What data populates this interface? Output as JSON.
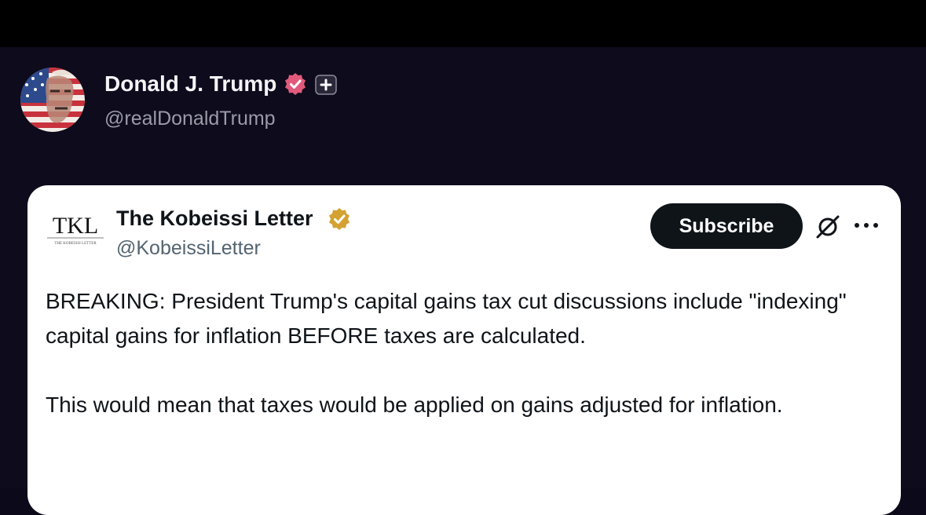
{
  "post": {
    "author": {
      "name": "Donald J. Trump",
      "handle": "@realDonaldTrump",
      "badge_color": "#e25a7b",
      "avatar_icon": "flag-portrait-avatar"
    },
    "quote": {
      "author": {
        "name": "The Kobeissi Letter",
        "handle": "@KobeissiLetter",
        "logo_text": "TKL",
        "logo_subtext": "THE KOBEISSI LETTER",
        "badge_color": "#d4a232"
      },
      "subscribe_label": "Subscribe",
      "body": [
        "BREAKING: President Trump's capital gains tax cut discussions include \"indexing\" capital gains for inflation BEFORE taxes are calculated.",
        "This would mean that taxes would be applied on gains adjusted for inflation."
      ]
    }
  },
  "colors": {
    "page_background": "#0d0b1c",
    "top_bar": "#000000",
    "card_background": "#ffffff",
    "subscribe_button": "#0f1419"
  }
}
